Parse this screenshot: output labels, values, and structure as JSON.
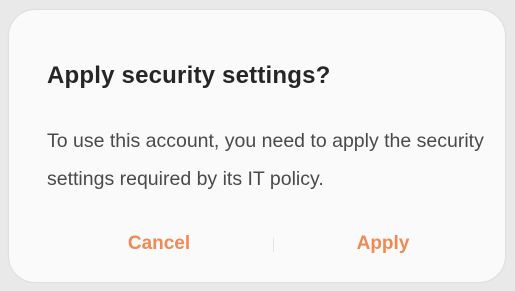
{
  "dialog": {
    "title": "Apply security settings?",
    "message": "To use this account, you need to apply the security settings required by its IT policy.",
    "cancel_label": "Cancel",
    "apply_label": "Apply"
  },
  "colors": {
    "accent": "#ef8a55",
    "title": "#262626",
    "body": "#4a4a4a",
    "dialog_bg": "#fafafa"
  }
}
